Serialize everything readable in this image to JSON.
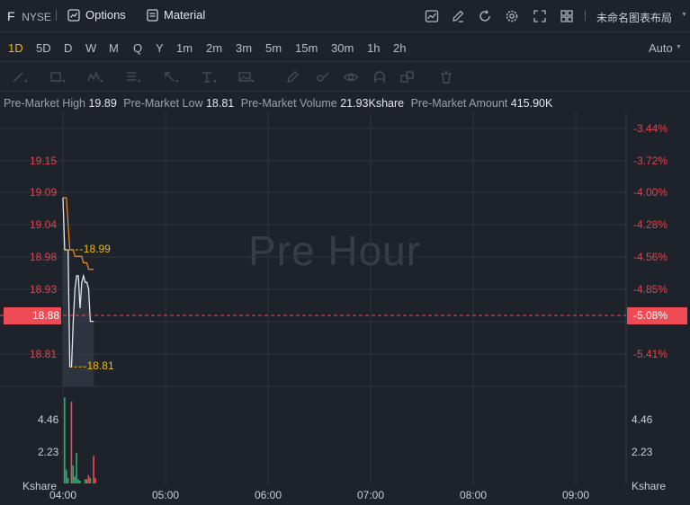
{
  "header": {
    "symbol": "F",
    "exchange": "NYSE",
    "options_label": "Options",
    "material_label": "Material",
    "layout_name": "未命名图表布局"
  },
  "intervals": [
    "1D",
    "5D",
    "D",
    "W",
    "M",
    "Q",
    "Y",
    "1m",
    "2m",
    "3m",
    "5m",
    "15m",
    "30m",
    "1h",
    "2h"
  ],
  "active_interval": "1D",
  "auto_label": "Auto",
  "info": [
    {
      "label": "Pre-Market High",
      "value": "19.89"
    },
    {
      "label": "Pre-Market Low",
      "value": "18.81"
    },
    {
      "label": "Pre-Market Volume",
      "value": "21.93Kshare"
    },
    {
      "label": "Pre-Market Amount",
      "value": "415.90K"
    }
  ],
  "watermark": "Pre Hour",
  "price_axis": [
    "19.15",
    "19.09",
    "19.04",
    "18.98",
    "18.93",
    "18.81"
  ],
  "percent_axis": [
    "-3.44%",
    "-3.72%",
    "-4.00%",
    "-4.28%",
    "-4.56%",
    "-4.85%",
    "-5.41%"
  ],
  "volume_axis": [
    "4.46",
    "2.23"
  ],
  "volume_unit": "Kshare",
  "time_axis": [
    "04:00",
    "05:00",
    "06:00",
    "07:00",
    "08:00",
    "09:00"
  ],
  "current_price": "18.88",
  "current_percent": "-5.08%",
  "session_high_label": "18.99",
  "session_low_label": "18.81",
  "colors": {
    "background": "#1e232b",
    "up": "#26b36b",
    "down": "#ef4b55",
    "average_line": "#f08c2a",
    "highlight": "#f0b90b"
  },
  "chart_data": {
    "type": "line",
    "price_ylim": [
      18.78,
      19.2
    ],
    "price_series": {
      "x": [
        "04:00",
        "04:01",
        "04:02",
        "04:03",
        "04:04",
        "04:05",
        "04:06",
        "04:07",
        "04:08",
        "04:09",
        "04:10",
        "04:11",
        "04:12",
        "04:13",
        "04:14",
        "04:15",
        "04:16",
        "04:17",
        "04:18"
      ],
      "values": [
        19.07,
        18.99,
        18.99,
        18.99,
        18.81,
        18.81,
        18.88,
        18.93,
        18.95,
        18.95,
        18.9,
        18.94,
        18.95,
        18.94,
        18.94,
        18.93,
        18.88,
        18.88,
        18.88
      ]
    },
    "average_series": {
      "x": [
        "04:00",
        "04:01",
        "04:02",
        "04:03",
        "04:04",
        "04:05",
        "04:06",
        "04:07",
        "04:08",
        "04:09",
        "04:10",
        "04:11",
        "04:12",
        "04:13",
        "04:14",
        "04:15",
        "04:16",
        "04:17",
        "04:18"
      ],
      "values": [
        19.07,
        19.07,
        19.07,
        19.03,
        18.99,
        18.99,
        18.99,
        18.98,
        18.98,
        18.98,
        18.98,
        18.98,
        18.97,
        18.97,
        18.97,
        18.96,
        18.96,
        18.96,
        18.96
      ]
    },
    "volume_ylim": [
      0,
      7
    ],
    "volume_series": [
      {
        "x": "04:00",
        "value": 6.2,
        "dir": "up"
      },
      {
        "x": "04:01",
        "value": 1.0,
        "dir": "up"
      },
      {
        "x": "04:02",
        "value": 0.4,
        "dir": "up"
      },
      {
        "x": "04:04",
        "value": 5.9,
        "dir": "down"
      },
      {
        "x": "04:05",
        "value": 1.3,
        "dir": "up"
      },
      {
        "x": "04:06",
        "value": 0.5,
        "dir": "up"
      },
      {
        "x": "04:07",
        "value": 2.2,
        "dir": "up"
      },
      {
        "x": "04:08",
        "value": 0.3,
        "dir": "up"
      },
      {
        "x": "04:09",
        "value": 0.2,
        "dir": "up"
      },
      {
        "x": "04:12",
        "value": 0.3,
        "dir": "up"
      },
      {
        "x": "04:13",
        "value": 0.3,
        "dir": "down"
      },
      {
        "x": "04:14",
        "value": 0.6,
        "dir": "down"
      },
      {
        "x": "04:15",
        "value": 0.4,
        "dir": "up"
      },
      {
        "x": "04:17",
        "value": 2.0,
        "dir": "down"
      },
      {
        "x": "04:18",
        "value": 0.4,
        "dir": "down"
      }
    ]
  }
}
